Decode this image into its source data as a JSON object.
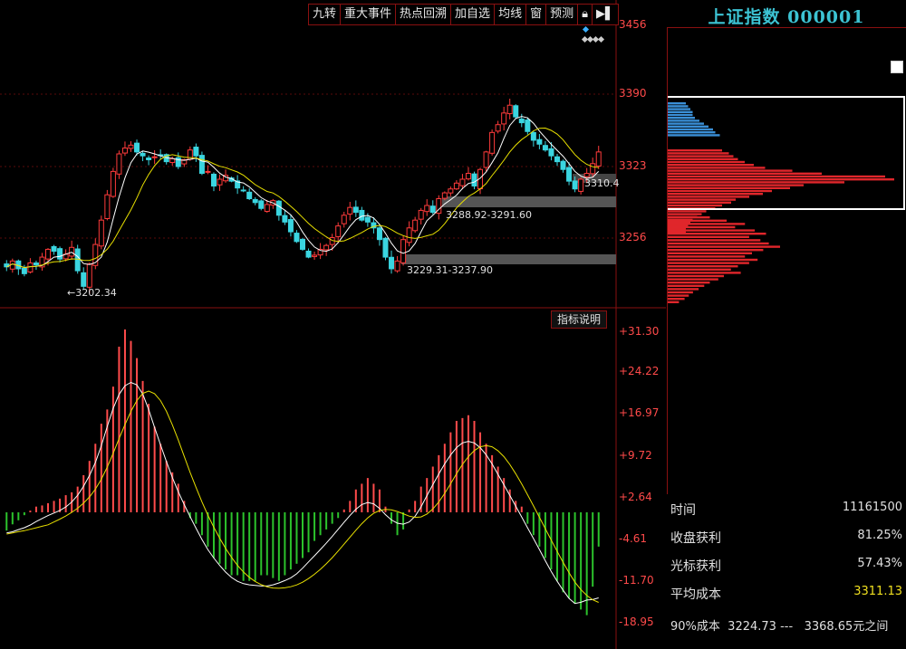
{
  "toolbar": {
    "buttons": [
      "九转",
      "重大事件",
      "热点回溯",
      "加自选",
      "均线",
      "窗",
      "预测"
    ]
  },
  "price_axis": [
    "3456",
    "3390",
    "3323",
    "3256"
  ],
  "indicator_axis": [
    "+31.30",
    "+24.22",
    "+16.97",
    "+9.72",
    "+2.64",
    "-4.61",
    "-11.70",
    "-18.95"
  ],
  "annotations": {
    "low_price": "3202.34",
    "zone_upper": "3288.92-3291.60",
    "zone_lower": "3229.31-3237.90",
    "last_price": "3310.4"
  },
  "indicator_button": "指标说明",
  "side": {
    "title": "上证指数 000001",
    "rows": [
      {
        "label": "时间",
        "value": "11161500"
      },
      {
        "label": "收盘获利",
        "value": "81.25%"
      },
      {
        "label": "光标获利",
        "value": "57.43%"
      },
      {
        "label": "平均成本",
        "value": "3311.13"
      }
    ],
    "range_label": "90%成本",
    "range_low": "3224.73",
    "range_sep": "---",
    "range_high": "3368.65",
    "range_suffix": "元之间"
  },
  "colors": {
    "up": "#ff3b3b",
    "down": "#3ad5e0",
    "ma5": "#ffffff",
    "ma10": "#e8e000",
    "macd_pos": "#ff4b4b",
    "macd_neg": "#2cc22c",
    "chip_blue": "#3a8fd6",
    "chip_red": "#e0262b"
  },
  "chart_data": [
    {
      "type": "candlestick",
      "y_range": [
        3180,
        3470
      ],
      "closes": [
        3222,
        3228,
        3220,
        3215,
        3226,
        3224,
        3232,
        3240,
        3238,
        3230,
        3235,
        3242,
        3218,
        3202,
        3225,
        3245,
        3270,
        3296,
        3320,
        3338,
        3344,
        3347,
        3340,
        3336,
        3332,
        3335,
        3337,
        3330,
        3333,
        3325,
        3332,
        3342,
        3336,
        3318,
        3320,
        3305,
        3312,
        3316,
        3310,
        3303,
        3300,
        3292,
        3288,
        3282,
        3286,
        3290,
        3275,
        3268,
        3258,
        3248,
        3240,
        3232,
        3234,
        3240,
        3244,
        3252,
        3264,
        3275,
        3283,
        3278,
        3270,
        3268,
        3262,
        3250,
        3232,
        3220,
        3228,
        3250,
        3262,
        3270,
        3280,
        3285,
        3278,
        3292,
        3298,
        3302,
        3308,
        3312,
        3318,
        3305,
        3322,
        3340,
        3360,
        3368,
        3380,
        3388,
        3376,
        3370,
        3361,
        3352,
        3348,
        3342,
        3336,
        3330,
        3322,
        3310,
        3302,
        3312,
        3318,
        3328,
        3340
      ],
      "macd_hist": [
        -3.2,
        -2.1,
        -1.4,
        -0.5,
        0.3,
        1.0,
        1.2,
        1.6,
        2.0,
        2.4,
        3.0,
        3.5,
        4.5,
        6.5,
        9,
        12,
        15.5,
        18,
        22,
        29,
        32,
        30,
        27,
        23,
        19,
        15,
        12,
        9,
        7,
        5,
        2,
        -1,
        -2,
        -4,
        -6,
        -8,
        -9,
        -10,
        -11,
        -11,
        -12,
        -12,
        -12,
        -11,
        -11,
        -11.5,
        -12,
        -11,
        -10,
        -9,
        -8,
        -7,
        -5,
        -4,
        -3,
        -2,
        -1,
        0.5,
        2,
        4,
        5,
        6,
        5,
        4,
        1,
        -2,
        -4,
        -3,
        0.5,
        2,
        4.5,
        6,
        8,
        10,
        12,
        14,
        16,
        16.5,
        17,
        16,
        14,
        12,
        10,
        8,
        6,
        4,
        2,
        1,
        -2,
        -4,
        -6,
        -8,
        -10,
        -12,
        -14,
        -15,
        -16,
        -17,
        -18,
        -13,
        -6
      ]
    },
    {
      "type": "bar",
      "title": "",
      "series": [
        {
          "name": "",
          "values": [
            8,
            9,
            10,
            11,
            11,
            12,
            14,
            16,
            18,
            20,
            21,
            23
          ]
        },
        {
          "name": "",
          "values": [
            24,
            27,
            29,
            31,
            34,
            38,
            43,
            55,
            68,
            96,
            100,
            78,
            60,
            54,
            46,
            42,
            36,
            30,
            28,
            24,
            21,
            17,
            15,
            13,
            11,
            10,
            9,
            8,
            8
          ]
        }
      ]
    }
  ]
}
